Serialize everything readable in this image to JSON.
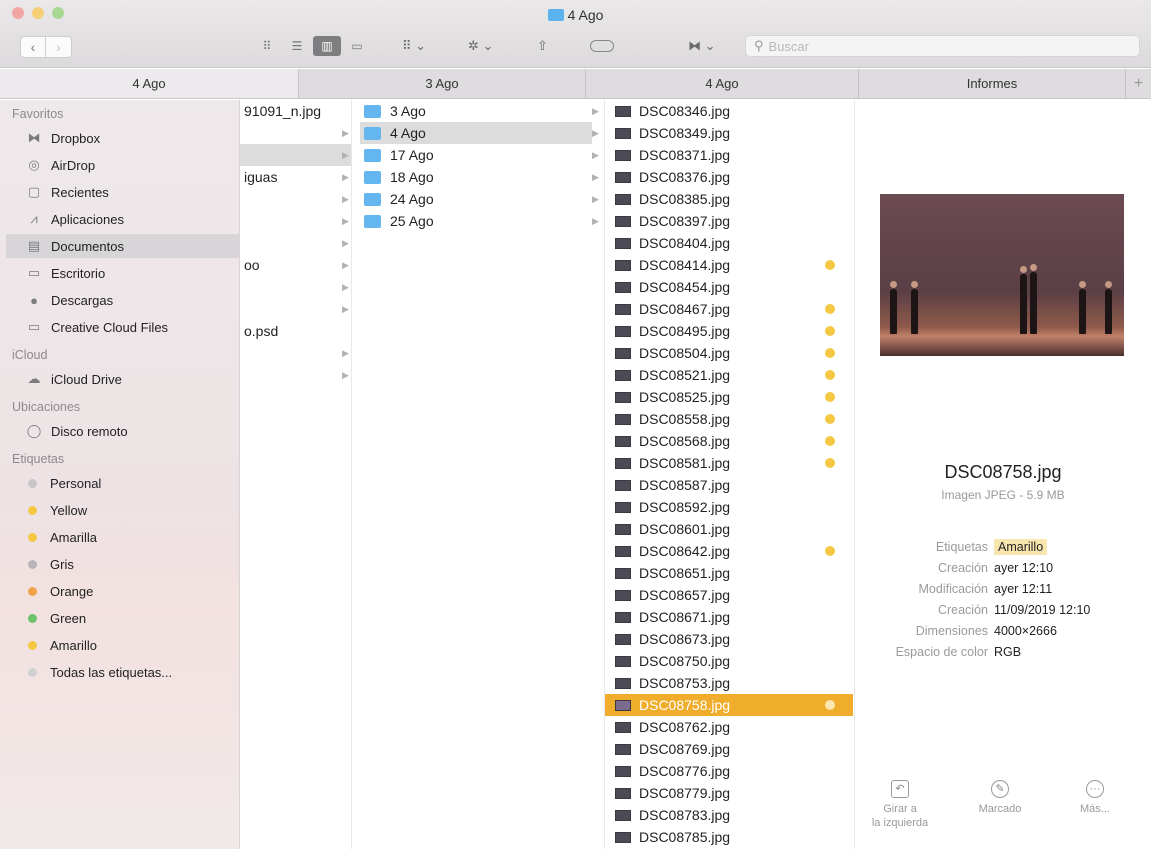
{
  "window": {
    "title": "4 Ago"
  },
  "toolbar": {
    "search_placeholder": "Buscar",
    "view_modes": [
      "icons",
      "list",
      "columns",
      "gallery"
    ],
    "active_view": "columns"
  },
  "tabs": [
    {
      "label": "4 Ago",
      "active": true
    },
    {
      "label": "3 Ago",
      "active": false
    },
    {
      "label": "4 Ago",
      "active": false
    },
    {
      "label": "Informes",
      "active": false
    }
  ],
  "sidebar": {
    "favorites_header": "Favoritos",
    "favorites": [
      {
        "label": "Dropbox",
        "icon": "dropbox-icon"
      },
      {
        "label": "AirDrop",
        "icon": "airdrop-icon"
      },
      {
        "label": "Recientes",
        "icon": "recents-icon"
      },
      {
        "label": "Aplicaciones",
        "icon": "applications-icon"
      },
      {
        "label": "Documentos",
        "icon": "documents-icon"
      },
      {
        "label": "Escritorio",
        "icon": "desktop-icon"
      },
      {
        "label": "Descargas",
        "icon": "downloads-icon"
      },
      {
        "label": "Creative Cloud Files",
        "icon": "folder-icon"
      }
    ],
    "icloud_header": "iCloud",
    "icloud": [
      {
        "label": "iCloud Drive",
        "icon": "cloud-icon"
      }
    ],
    "locations_header": "Ubicaciones",
    "locations": [
      {
        "label": "Disco remoto",
        "icon": "disc-icon"
      }
    ],
    "tags_header": "Etiquetas",
    "tags": [
      {
        "label": "Personal",
        "color": "#c9c6c9"
      },
      {
        "label": "Yellow",
        "color": "#f5c843"
      },
      {
        "label": "Amarilla",
        "color": "#f5c843"
      },
      {
        "label": "Gris",
        "color": "#b7b5b8"
      },
      {
        "label": "Orange",
        "color": "#f3a24a"
      },
      {
        "label": "Green",
        "color": "#6cc36a"
      },
      {
        "label": "Amarillo",
        "color": "#f5c843"
      },
      {
        "label": "Todas las etiquetas...",
        "color": "#d2d0d2"
      }
    ]
  },
  "column1": {
    "fragments": [
      "91091_n.jpg",
      "iguas",
      "oo",
      "o.psd"
    ]
  },
  "column2": {
    "folders": [
      "3 Ago",
      "4 Ago",
      "17 Ago",
      "18 Ago",
      "24 Ago",
      "25 Ago"
    ]
  },
  "column3": {
    "files": [
      "DSC08346.jpg",
      "DSC08349.jpg",
      "DSC08371.jpg",
      "DSC08376.jpg",
      "DSC08385.jpg",
      "DSC08397.jpg",
      "DSC08404.jpg",
      "DSC08414.jpg",
      "DSC08454.jpg",
      "DSC08467.jpg",
      "DSC08495.jpg",
      "DSC08504.jpg",
      "DSC08521.jpg",
      "DSC08525.jpg",
      "DSC08558.jpg",
      "DSC08568.jpg",
      "DSC08581.jpg",
      "DSC08587.jpg",
      "DSC08592.jpg",
      "DSC08601.jpg",
      "DSC08642.jpg",
      "DSC08651.jpg",
      "DSC08657.jpg",
      "DSC08671.jpg",
      "DSC08673.jpg",
      "DSC08750.jpg",
      "DSC08753.jpg",
      "DSC08758.jpg",
      "DSC08762.jpg",
      "DSC08769.jpg",
      "DSC08776.jpg",
      "DSC08779.jpg",
      "DSC08783.jpg",
      "DSC08785.jpg"
    ],
    "selected": "DSC08758.jpg",
    "yellow_tagged": [
      "DSC08414.jpg",
      "DSC08467.jpg",
      "DSC08495.jpg",
      "DSC08504.jpg",
      "DSC08521.jpg",
      "DSC08525.jpg",
      "DSC08558.jpg",
      "DSC08568.jpg",
      "DSC08581.jpg",
      "DSC08642.jpg",
      "DSC08758.jpg"
    ]
  },
  "preview": {
    "filename": "DSC08758.jpg",
    "kind": "Imagen JPEG - 5.9 MB",
    "meta": [
      {
        "label": "Etiquetas",
        "value": "Amarillo"
      },
      {
        "label": "Creación",
        "value": "ayer 12:10"
      },
      {
        "label": "Modificación",
        "value": "ayer 12:11"
      },
      {
        "label": "Creación",
        "value": "11/09/2019 12:10"
      },
      {
        "label": "Dimensiones",
        "value": "4000×2666"
      },
      {
        "label": "Espacio de color",
        "value": "RGB"
      }
    ],
    "actions": [
      {
        "label": "Girar a\nla izquierda",
        "icon": "rotate-left-icon"
      },
      {
        "label": "Marcado",
        "icon": "markup-icon"
      },
      {
        "label": "Más...",
        "icon": "more-icon"
      }
    ]
  }
}
